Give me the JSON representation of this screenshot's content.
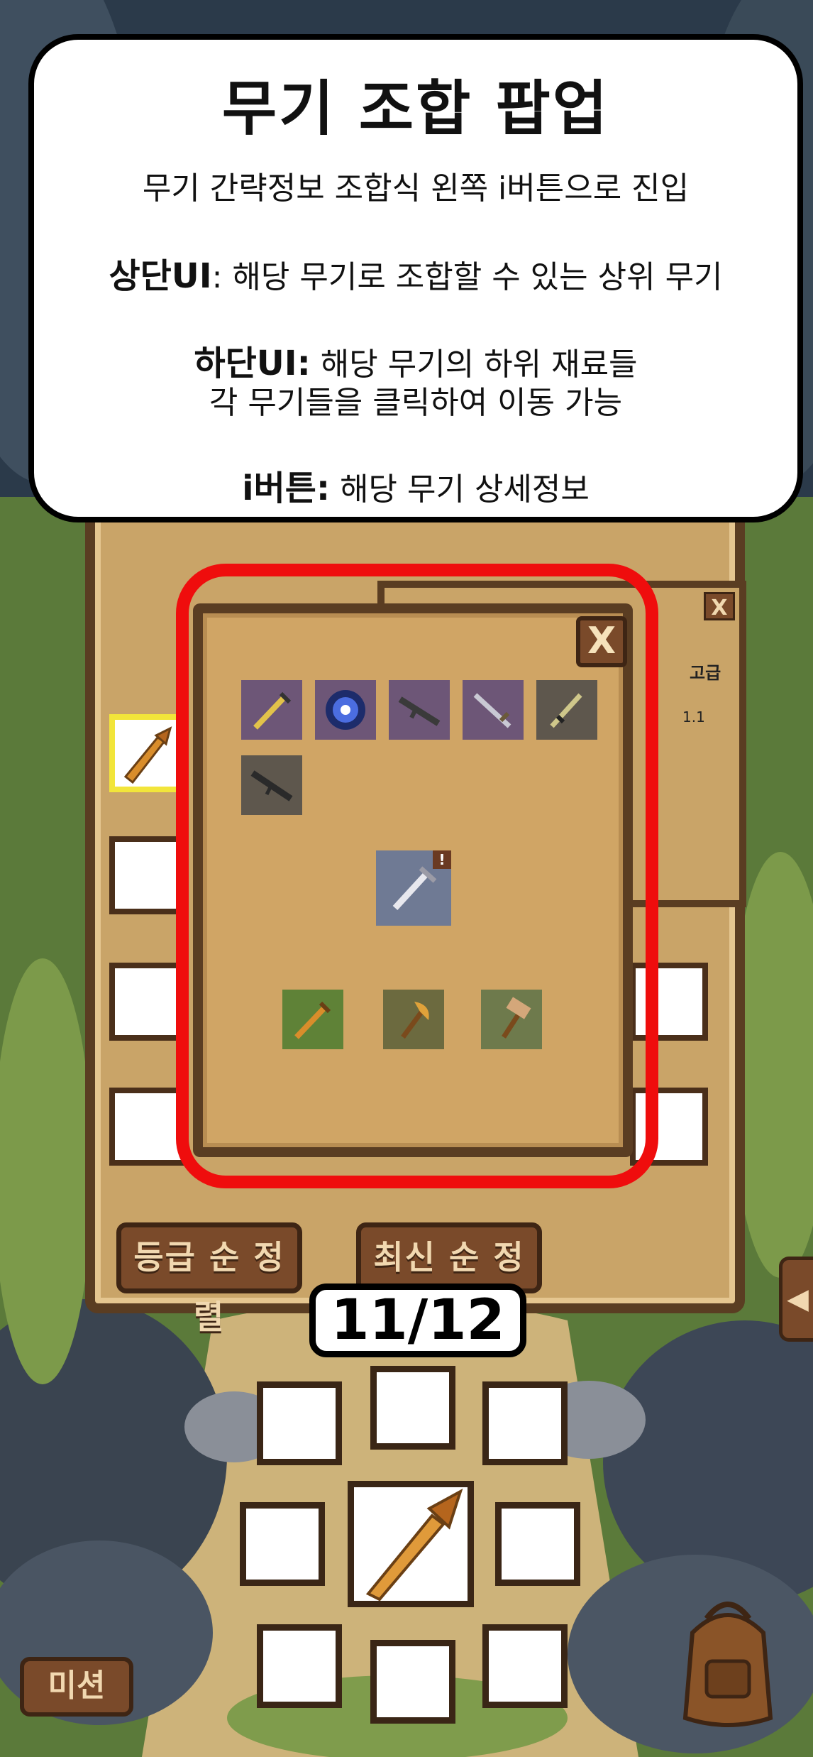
{
  "annotation": {
    "title": "무기 조합 팝업",
    "line1": "무기 간략정보 조합식 왼쪽 i버튼으로 진입",
    "top_ui_label": "상단UI",
    "top_ui_text": ": 해당 무기로 조합할 수 있는 상위 무기",
    "bottom_ui_label": "하단UI:",
    "bottom_ui_text": " 해당 무기의 하위 재료들",
    "bottom_ui_text2": "각 무기들을 클릭하여 이동 가능",
    "ibutton_label": "i버튼:",
    "ibutton_text": " 해당 무기 상세정보"
  },
  "back_popup": {
    "close": "X",
    "grade": "고급",
    "stat": "1.1"
  },
  "combo_popup": {
    "close": "X",
    "upper_weapons": [
      {
        "icon": "golden-sword-icon",
        "bg": "purple"
      },
      {
        "icon": "blue-orb-icon",
        "bg": "purple"
      },
      {
        "icon": "rifle-icon",
        "bg": "purple"
      },
      {
        "icon": "long-blade-icon",
        "bg": "purple"
      },
      {
        "icon": "dagger-icon",
        "bg": "gray"
      },
      {
        "icon": "dark-rifle-icon",
        "bg": "gray"
      }
    ],
    "current_weapon": {
      "icon": "silver-sword-icon",
      "badge": "!"
    },
    "materials": [
      {
        "icon": "wooden-sword-icon",
        "bg": "green"
      },
      {
        "icon": "axe-icon",
        "bg": "olive"
      },
      {
        "icon": "hammer-icon",
        "bg": "moss"
      }
    ]
  },
  "sort_buttons": {
    "grade": "등급 순 정렬",
    "recent": "최신 순 정렬"
  },
  "page_counter": "11/12",
  "mission_button": "미션",
  "side_arrow": "◀",
  "colors": {
    "highlight": "#ef0d0d",
    "wood_dark": "#5a3d22",
    "parchment": "#d0a565"
  }
}
